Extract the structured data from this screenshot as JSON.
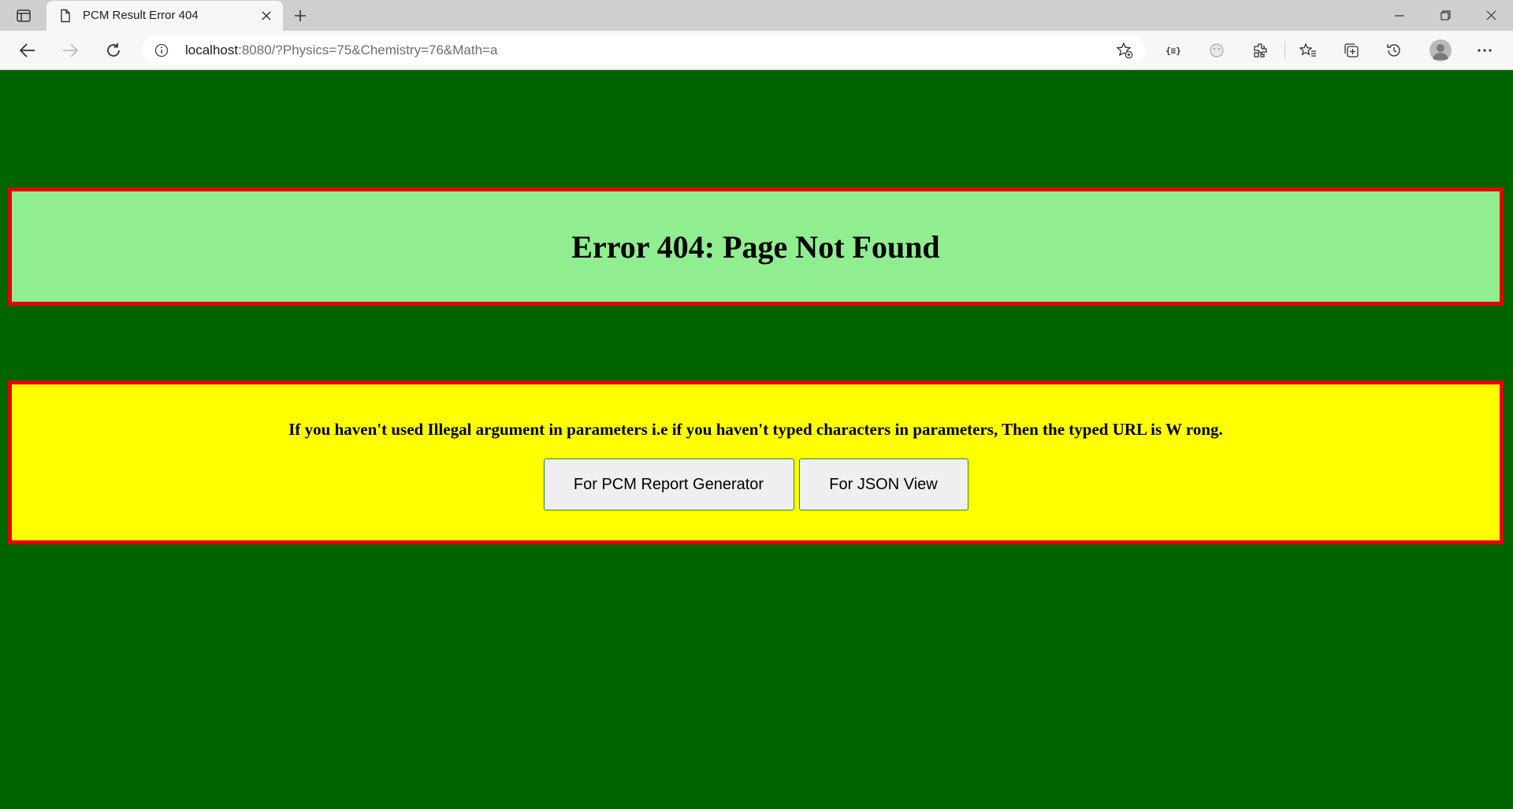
{
  "browser": {
    "tab_title": "PCM Result Error 404",
    "url_host": "localhost",
    "url_rest": ":8080/?Physics=75&Chemistry=76&Math=a"
  },
  "page": {
    "heading": "Error 404: Page Not Found",
    "message": "If you haven't used Illegal argument in parameters i.e if you haven't typed characters in parameters, Then the typed URL is W rong.",
    "buttons": {
      "pcm_label": "For PCM Report Generator",
      "json_label": "For JSON View"
    }
  },
  "colors": {
    "page_bg": "#006400",
    "banner_bg": "#90ee90",
    "notice_bg": "#ffff00",
    "border": "#e30000"
  }
}
